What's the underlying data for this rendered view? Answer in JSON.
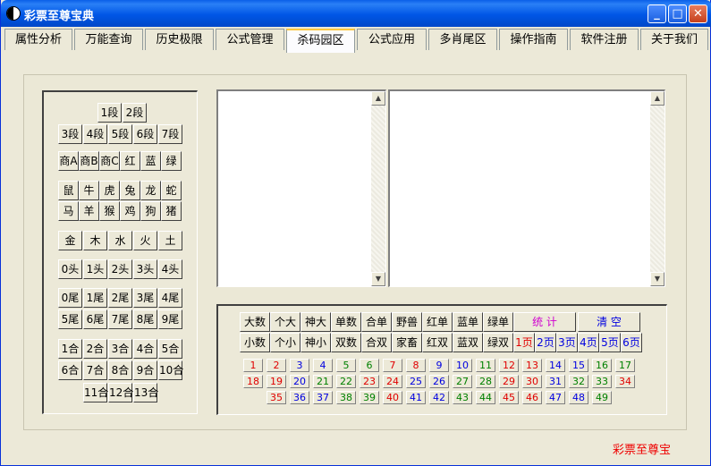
{
  "window": {
    "title": "彩票至尊宝典",
    "min": "_",
    "max": "□",
    "close": "✕"
  },
  "tabs": [
    "属性分析",
    "万能查询",
    "历史极限",
    "公式管理",
    "杀码园区",
    "公式应用",
    "多肖尾区",
    "操作指南",
    "软件注册",
    "关于我们"
  ],
  "active_tab": "杀码园区",
  "left": {
    "segments": [
      "1段",
      "2段",
      "3段",
      "4段",
      "5段",
      "6段",
      "7段"
    ],
    "business": [
      "商A",
      "商B",
      "商C",
      "红",
      "蓝",
      "绿"
    ],
    "zodiac": [
      "鼠",
      "牛",
      "虎",
      "兔",
      "龙",
      "蛇",
      "马",
      "羊",
      "猴",
      "鸡",
      "狗",
      "猪"
    ],
    "elements": [
      "金",
      "木",
      "水",
      "火",
      "土"
    ],
    "heads": [
      "0头",
      "1头",
      "2头",
      "3头",
      "4头"
    ],
    "tails": [
      "0尾",
      "1尾",
      "2尾",
      "3尾",
      "4尾",
      "5尾",
      "6尾",
      "7尾",
      "8尾",
      "9尾"
    ],
    "sums": [
      "1合",
      "2合",
      "3合",
      "4合",
      "5合",
      "6合",
      "7合",
      "8合",
      "9合",
      "10合",
      "11合",
      "12合",
      "13合"
    ]
  },
  "filters": {
    "row1": [
      "大数",
      "个大",
      "神大",
      "单数",
      "合单",
      "野兽",
      "红单",
      "蓝单",
      "绿单"
    ],
    "row2": [
      "小数",
      "个小",
      "神小",
      "双数",
      "合双",
      "家畜",
      "红双",
      "蓝双",
      "绿双"
    ],
    "stats": "统 计",
    "clear": "清 空",
    "pages": [
      "1页",
      "2页",
      "3页",
      "4页",
      "5页",
      "6页"
    ]
  },
  "numbers": [
    {
      "n": "1",
      "c": "r"
    },
    {
      "n": "2",
      "c": "r"
    },
    {
      "n": "3",
      "c": "b"
    },
    {
      "n": "4",
      "c": "b"
    },
    {
      "n": "5",
      "c": "g"
    },
    {
      "n": "6",
      "c": "g"
    },
    {
      "n": "7",
      "c": "r"
    },
    {
      "n": "8",
      "c": "r"
    },
    {
      "n": "9",
      "c": "b"
    },
    {
      "n": "10",
      "c": "b"
    },
    {
      "n": "11",
      "c": "g"
    },
    {
      "n": "12",
      "c": "r"
    },
    {
      "n": "13",
      "c": "r"
    },
    {
      "n": "14",
      "c": "b"
    },
    {
      "n": "15",
      "c": "b"
    },
    {
      "n": "16",
      "c": "g"
    },
    {
      "n": "17",
      "c": "g"
    },
    {
      "n": "18",
      "c": "r"
    },
    {
      "n": "19",
      "c": "r"
    },
    {
      "n": "20",
      "c": "b"
    },
    {
      "n": "21",
      "c": "g"
    },
    {
      "n": "22",
      "c": "g"
    },
    {
      "n": "23",
      "c": "r"
    },
    {
      "n": "24",
      "c": "r"
    },
    {
      "n": "25",
      "c": "b"
    },
    {
      "n": "26",
      "c": "b"
    },
    {
      "n": "27",
      "c": "g"
    },
    {
      "n": "28",
      "c": "g"
    },
    {
      "n": "29",
      "c": "r"
    },
    {
      "n": "30",
      "c": "r"
    },
    {
      "n": "31",
      "c": "b"
    },
    {
      "n": "32",
      "c": "g"
    },
    {
      "n": "33",
      "c": "g"
    },
    {
      "n": "34",
      "c": "r"
    },
    {
      "n": "35",
      "c": "r"
    },
    {
      "n": "36",
      "c": "b"
    },
    {
      "n": "37",
      "c": "b"
    },
    {
      "n": "38",
      "c": "g"
    },
    {
      "n": "39",
      "c": "g"
    },
    {
      "n": "40",
      "c": "r"
    },
    {
      "n": "41",
      "c": "b"
    },
    {
      "n": "42",
      "c": "b"
    },
    {
      "n": "43",
      "c": "g"
    },
    {
      "n": "44",
      "c": "g"
    },
    {
      "n": "45",
      "c": "r"
    },
    {
      "n": "46",
      "c": "r"
    },
    {
      "n": "47",
      "c": "b"
    },
    {
      "n": "48",
      "c": "b"
    },
    {
      "n": "49",
      "c": "g"
    }
  ],
  "colors": {
    "r": "#e00000",
    "b": "#0000e0",
    "g": "#008000",
    "stats": "#d000d0",
    "clear": "#0000e0"
  },
  "footer": "彩票至尊宝"
}
